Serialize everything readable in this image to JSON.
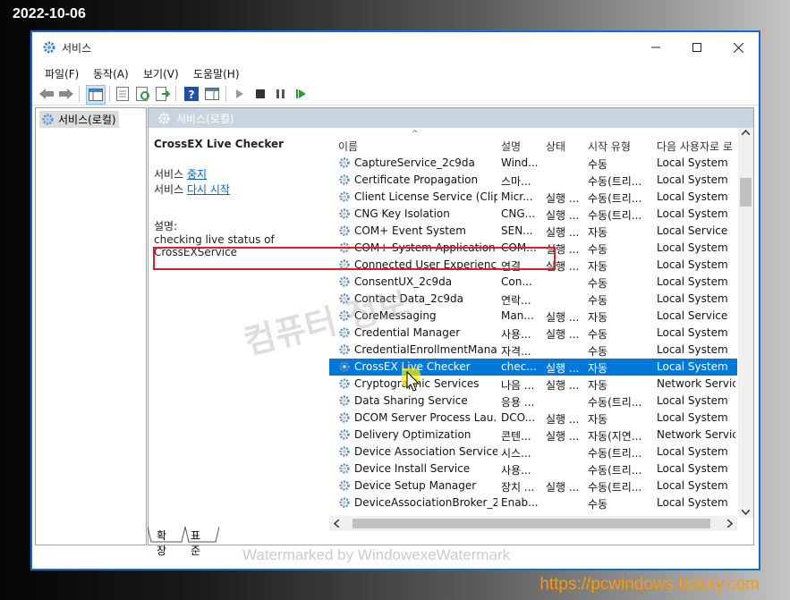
{
  "overlay": {
    "date": "2022-10-06",
    "site": "https://pcwindows.tistory.com",
    "watermark_center": "컴퓨터 정보",
    "watermark_bottom": "Watermarked by WindowexeWatermark"
  },
  "window": {
    "title": "서비스",
    "minimize": "—",
    "maximize": "☐",
    "close": "✕"
  },
  "menu": [
    "파일(F)",
    "동작(A)",
    "보기(V)",
    "도움말(H)"
  ],
  "tree": {
    "root": "서비스(로컬)"
  },
  "pane_header": "서비스(로컬)",
  "detail": {
    "title": "CrossEX Live Checker",
    "stop_prefix": "서비스",
    "stop_link": "중지",
    "restart_prefix": "서비스",
    "restart_link": "다시 시작",
    "desc_label": "설명:",
    "desc_text": "checking live status of CrossEXService"
  },
  "columns": {
    "name": "이름",
    "desc": "설명",
    "status": "상태",
    "startup": "시작 유형",
    "logon": "다음 사용자로 로"
  },
  "rows": [
    {
      "name": "CaptureService_2c9da",
      "desc": "Wind...",
      "status": "",
      "startup": "수동",
      "logon": "Local System"
    },
    {
      "name": "Certificate Propagation",
      "desc": "스마...",
      "status": "",
      "startup": "수동(트리...",
      "logon": "Local System"
    },
    {
      "name": "Client License Service (Clip...",
      "desc": "Micr...",
      "status": "실행 ...",
      "startup": "수동(트리...",
      "logon": "Local System"
    },
    {
      "name": "CNG Key Isolation",
      "desc": "CNG...",
      "status": "실행 ...",
      "startup": "수동(트리...",
      "logon": "Local System"
    },
    {
      "name": "COM+ Event System",
      "desc": "SEN...",
      "status": "실행 ...",
      "startup": "자동",
      "logon": "Local Service"
    },
    {
      "name": "COM+ System Application",
      "desc": "COM...",
      "status": "실행 ...",
      "startup": "수동",
      "logon": "Local System"
    },
    {
      "name": "Connected User Experience...",
      "desc": "연결...",
      "status": "실행 ...",
      "startup": "자동",
      "logon": "Local System"
    },
    {
      "name": "ConsentUX_2c9da",
      "desc": "Con...",
      "status": "",
      "startup": "수동",
      "logon": "Local System"
    },
    {
      "name": "Contact Data_2c9da",
      "desc": "연락...",
      "status": "",
      "startup": "수동",
      "logon": "Local System"
    },
    {
      "name": "CoreMessaging",
      "desc": "Man...",
      "status": "실행 ...",
      "startup": "자동",
      "logon": "Local Service"
    },
    {
      "name": "Credential Manager",
      "desc": "사용...",
      "status": "실행 ...",
      "startup": "수동",
      "logon": "Local System"
    },
    {
      "name": "CredentialEnrollmentMana...",
      "desc": "자격...",
      "status": "",
      "startup": "수동",
      "logon": "Local System"
    },
    {
      "name": "CrossEX Live Checker",
      "desc": "chec...",
      "status": "실행 ...",
      "startup": "자동",
      "logon": "Local System",
      "selected": true
    },
    {
      "name": "Cryptographic Services",
      "desc": "나음 ...",
      "status": "실행 ...",
      "startup": "자동",
      "logon": "Network Service"
    },
    {
      "name": "Data Sharing Service",
      "desc": "응용 ...",
      "status": "",
      "startup": "수동(트리...",
      "logon": "Local System"
    },
    {
      "name": "DCOM Server Process Lau...",
      "desc": "DCO...",
      "status": "실행 ...",
      "startup": "자동",
      "logon": "Local System"
    },
    {
      "name": "Delivery Optimization",
      "desc": "콘텐...",
      "status": "실행 ...",
      "startup": "자동(지연...",
      "logon": "Network Service"
    },
    {
      "name": "Device Association Service",
      "desc": "시스...",
      "status": "",
      "startup": "수동(트리...",
      "logon": "Local System"
    },
    {
      "name": "Device Install Service",
      "desc": "사용...",
      "status": "",
      "startup": "수동(트리...",
      "logon": "Local System"
    },
    {
      "name": "Device Setup Manager",
      "desc": "장치 ...",
      "status": "실행 ...",
      "startup": "수동(트리...",
      "logon": "Local System"
    },
    {
      "name": "DeviceAssociationBroker_2...",
      "desc": "Enab...",
      "status": "",
      "startup": "수동",
      "logon": "Local System"
    }
  ],
  "tabs": [
    "확장",
    "표준"
  ],
  "colors": {
    "selection": "#0078d7",
    "highlight_box": "#e21d1d",
    "pane_header": "#c9d4e1"
  }
}
